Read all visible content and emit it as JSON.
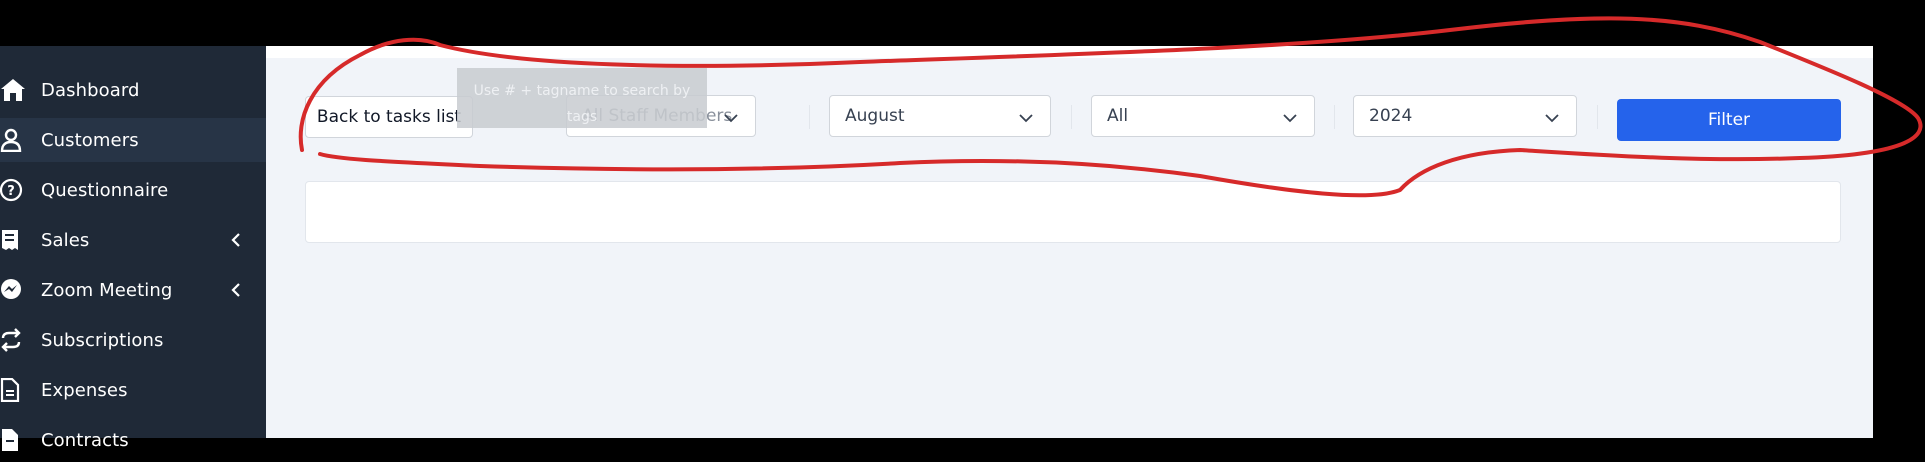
{
  "sidebar": {
    "items": [
      {
        "label": "Dashboard",
        "icon": "home-icon"
      },
      {
        "label": "Customers",
        "icon": "user-icon"
      },
      {
        "label": "Questionnaire",
        "icon": "question-circle-icon"
      },
      {
        "label": "Sales",
        "icon": "receipt-icon"
      },
      {
        "label": "Zoom Meeting",
        "icon": "messenger-icon"
      },
      {
        "label": "Subscriptions",
        "icon": "repeat-icon"
      },
      {
        "label": "Expenses",
        "icon": "document-icon"
      },
      {
        "label": "Contracts",
        "icon": "file-icon"
      }
    ]
  },
  "toolbar": {
    "back_label": "Back to tasks list",
    "tooltip_text": "Use # + tagname to search by tags",
    "staff_select": "All Staff Members",
    "month_select": "August",
    "status_select": "All",
    "year_select": "2024",
    "filter_label": "Filter"
  },
  "colors": {
    "sidebar_bg": "#1f2937",
    "main_bg": "#f1f4f9",
    "primary": "#2563eb",
    "annotation": "#d62a2a"
  }
}
